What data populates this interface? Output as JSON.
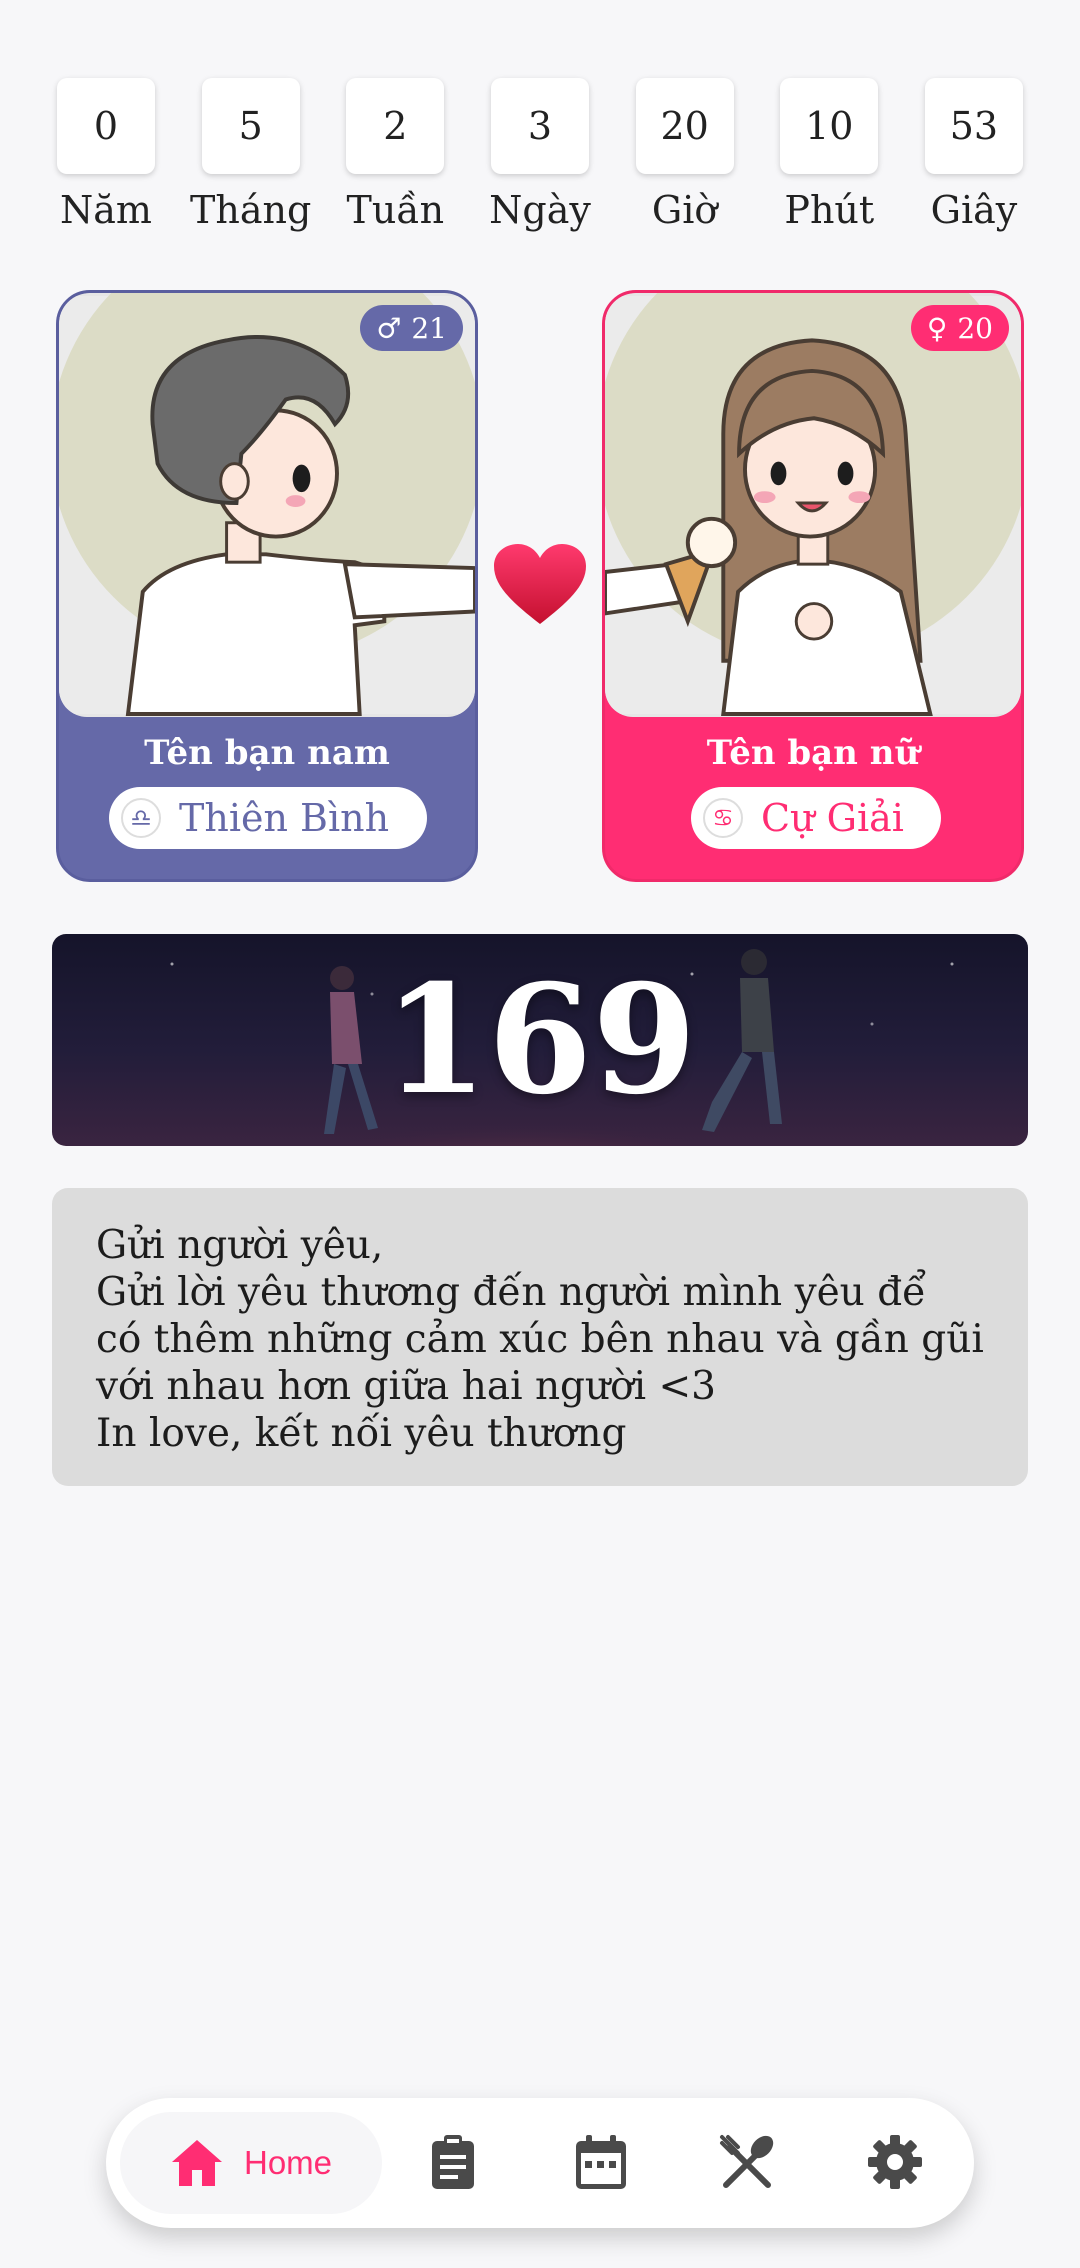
{
  "countdown": [
    {
      "value": "0",
      "label": "Năm"
    },
    {
      "value": "5",
      "label": "Tháng"
    },
    {
      "value": "2",
      "label": "Tuần"
    },
    {
      "value": "3",
      "label": "Ngày"
    },
    {
      "value": "20",
      "label": "Giờ"
    },
    {
      "value": "10",
      "label": "Phút"
    },
    {
      "value": "53",
      "label": "Giây"
    }
  ],
  "male": {
    "age": "21",
    "name": "Tên bạn nam",
    "zodiac": "Thiên Bình",
    "zodiac_icon": "libra-icon",
    "color": "#6569a8"
  },
  "female": {
    "age": "20",
    "name": "Tên bạn nữ",
    "zodiac": "Cự Giải",
    "zodiac_icon": "cancer-icon",
    "color": "#ff2d73"
  },
  "days_together": "169",
  "message": {
    "lines": [
      "Gửi người yêu,",
      "Gửi lời yêu thương đến người mình yêu để",
      "có thêm những cảm xúc bên nhau và gần gũi",
      "với nhau hơn giữa hai người <3",
      "In love, kết nối yêu thương"
    ]
  },
  "nav": {
    "active": "home",
    "home_label": "Home",
    "items": [
      "home-icon",
      "clipboard-icon",
      "calendar-icon",
      "utensils-icon",
      "gear-icon"
    ],
    "accent": "#ff2d73",
    "icon_color": "#4a4a4a"
  }
}
